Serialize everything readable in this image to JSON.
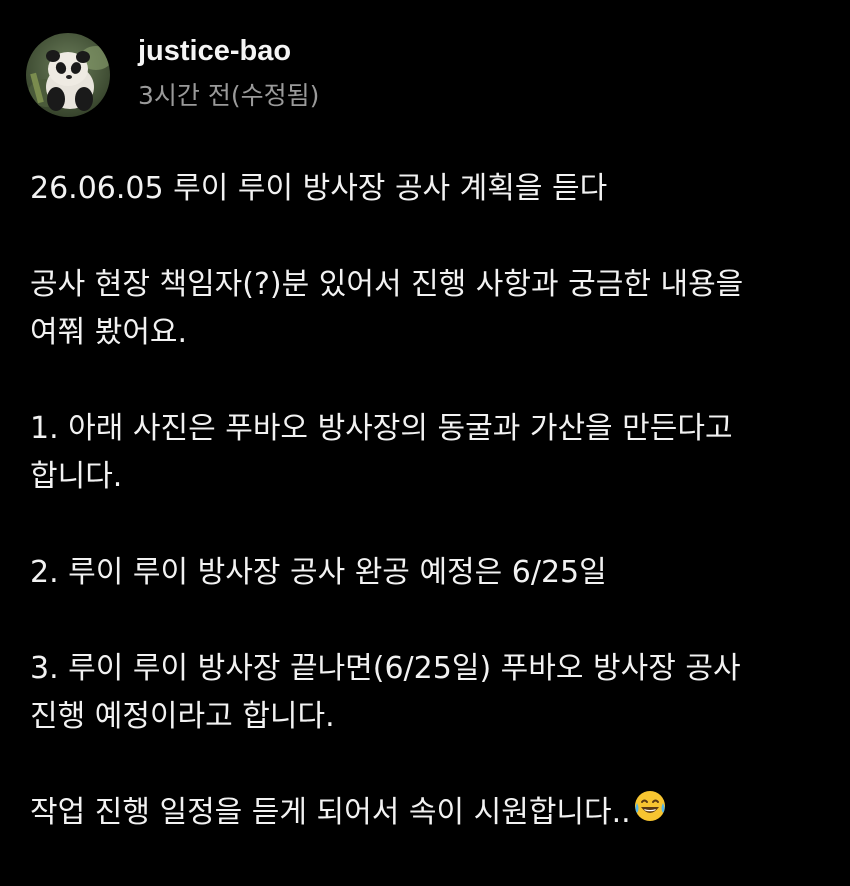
{
  "post": {
    "author": {
      "username": "justice-bao"
    },
    "timestamp": "3시간 전(수정됨)",
    "paragraphs": [
      {
        "lines": [
          "26.06.05 루이 루이 방사장 공사 계획을 듣다"
        ]
      },
      {
        "lines": [
          "공사 현장 책임자(?)분 있어서 진행 사항과 궁금한 내용을",
          "여쭤 봤어요."
        ]
      },
      {
        "lines": [
          "1. 아래 사진은 푸바오 방사장의 동굴과 가산을 만든다고",
          "합니다."
        ]
      },
      {
        "lines": [
          "2. 루이 루이 방사장 공사 완공 예정은 6/25일"
        ]
      },
      {
        "lines": [
          "3. 루이 루이 방사장 끝나면(6/25일)  푸바오 방사장 공사",
          "진행 예정이라고 합니다."
        ]
      },
      {
        "lines": [
          "작업 진행 일정을 듣게 되어서 속이 시원합니다.."
        ]
      }
    ],
    "closing_emoji": "tears-of-joy-emoji-icon"
  },
  "colors": {
    "background": "#000000",
    "text": "#f2f2f2",
    "muted": "#9a9a9a"
  }
}
